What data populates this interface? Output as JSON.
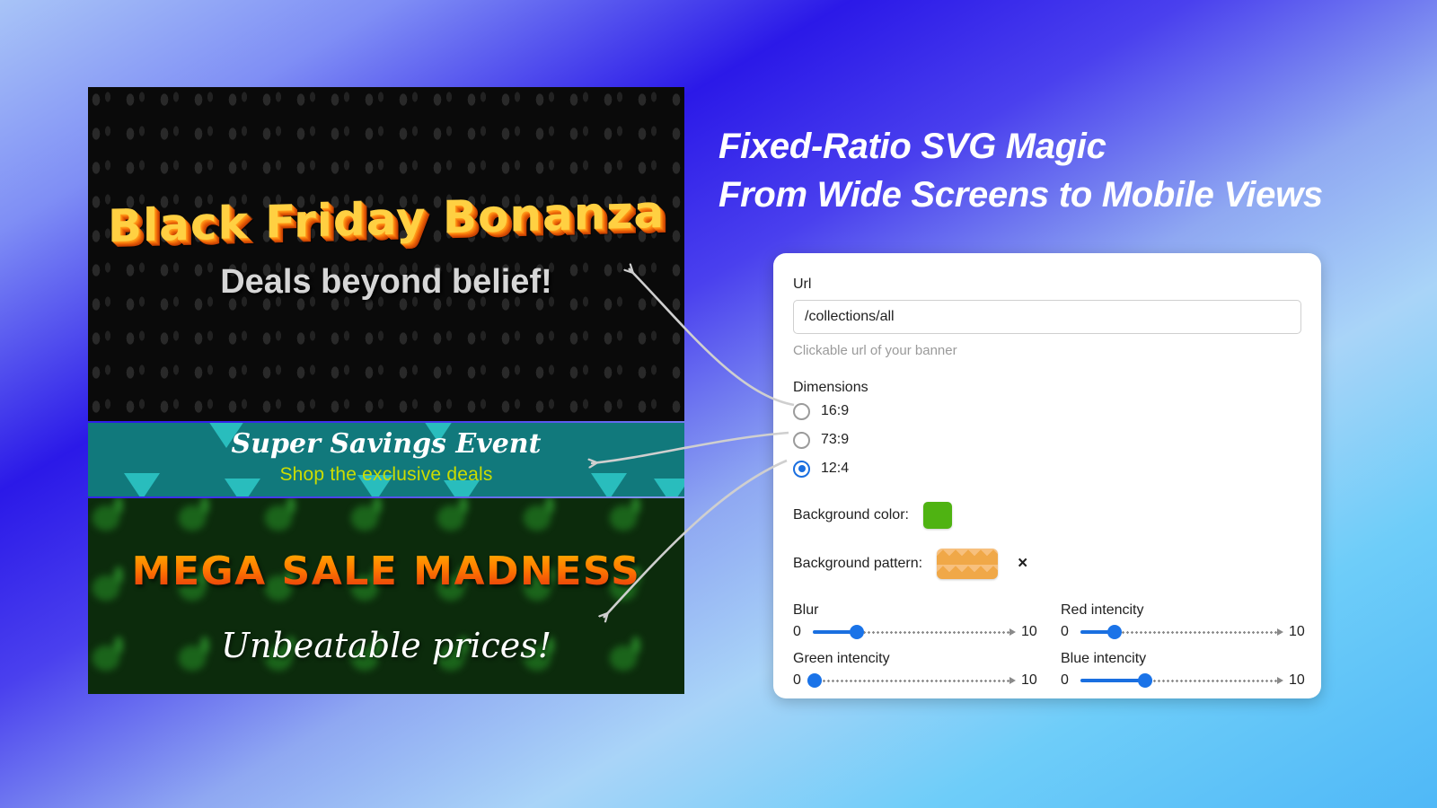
{
  "headline": {
    "line1": "Fixed-Ratio SVG Magic",
    "line2": "From Wide Screens to Mobile Views"
  },
  "banners": [
    {
      "name": "black-friday",
      "title": "Black Friday Bonanza",
      "subtitle": "Deals beyond belief!",
      "background_color": "#0a0a0a",
      "title_color": "#ffd042",
      "subtitle_color": "#d6d6d6",
      "ratio": "16:9"
    },
    {
      "name": "super-savings",
      "title": "Super Savings Event",
      "subtitle": "Shop the exclusive deals",
      "background_color": "#11797c",
      "title_color": "#ffffff",
      "subtitle_color": "#ccdd00",
      "ratio": "73:9"
    },
    {
      "name": "mega-sale",
      "title": "MEGA SALE MADNESS",
      "subtitle": "Unbeatable prices!",
      "background_color": "#0c2b0c",
      "title_color": "#ff7a00",
      "subtitle_color": "#ffffff",
      "ratio": "12:4"
    }
  ],
  "form": {
    "url": {
      "label": "Url",
      "value": "/collections/all",
      "placeholder": "/collections/all",
      "help": "Clickable url of your banner"
    },
    "dimensions": {
      "label": "Dimensions",
      "options": [
        {
          "label": "16:9",
          "selected": false
        },
        {
          "label": "73:9",
          "selected": false
        },
        {
          "label": "12:4",
          "selected": true
        }
      ]
    },
    "background_color": {
      "label": "Background color:",
      "value": "#4fb312"
    },
    "background_pattern": {
      "label": "Background pattern:",
      "value": "#f0a848",
      "clear_label": "×"
    },
    "sliders": [
      {
        "label": "Blur",
        "min": "0",
        "max": "10",
        "percent": 22
      },
      {
        "label": "Red intencity",
        "min": "0",
        "max": "10",
        "percent": 17
      },
      {
        "label": "Green intencity",
        "min": "0",
        "max": "10",
        "percent": 1
      },
      {
        "label": "Blue intencity",
        "min": "0",
        "max": "10",
        "percent": 32
      }
    ]
  },
  "colors": {
    "accent": "#1a6fe0",
    "card_background": "#ffffff",
    "arrow": "#cfcfcf"
  }
}
